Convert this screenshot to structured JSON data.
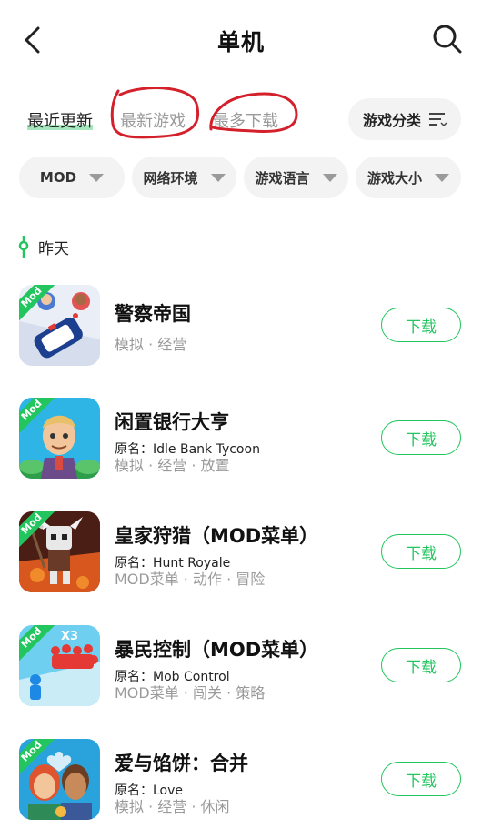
{
  "header": {
    "title": "单机",
    "back_icon": "chevron-left-icon",
    "search_icon": "search-icon"
  },
  "sort_tabs": [
    {
      "label": "最近更新",
      "active": true
    },
    {
      "label": "最新游戏",
      "active": false
    },
    {
      "label": "最多下载",
      "active": false
    }
  ],
  "category_button": {
    "label": "游戏分类",
    "icon": "filter-lines-icon"
  },
  "filters": [
    {
      "label": "MOD"
    },
    {
      "label": "网络环境"
    },
    {
      "label": "游戏语言"
    },
    {
      "label": "游戏大小"
    }
  ],
  "section_label": "昨天",
  "colors": {
    "accent": "#22c55e",
    "annotation": "#d4202a"
  },
  "apps": [
    {
      "title": "警察帝国",
      "original": "",
      "tags": "模拟 · 经营",
      "badge": "Mod",
      "button": "下载"
    },
    {
      "title": "闲置银行大亨",
      "original": "原名：Idle Bank Tycoon",
      "tags": "模拟 · 经营 · 放置",
      "badge": "Mod",
      "button": "下载"
    },
    {
      "title": "皇家狩猎（MOD菜单）",
      "original": "原名：Hunt Royale",
      "tags": "MOD菜单 · 动作 · 冒险",
      "badge": "Mod",
      "button": "下载"
    },
    {
      "title": "暴民控制（MOD菜单）",
      "original": "原名：Mob Control",
      "tags": "MOD菜单 · 闯关 · 策略",
      "badge": "Mod",
      "button": "下载"
    },
    {
      "title": "爱与馅饼：合并",
      "original": "原名：Love",
      "tags": "模拟 · 经营 · 休闲",
      "badge": "Mod",
      "button": "下载"
    }
  ]
}
